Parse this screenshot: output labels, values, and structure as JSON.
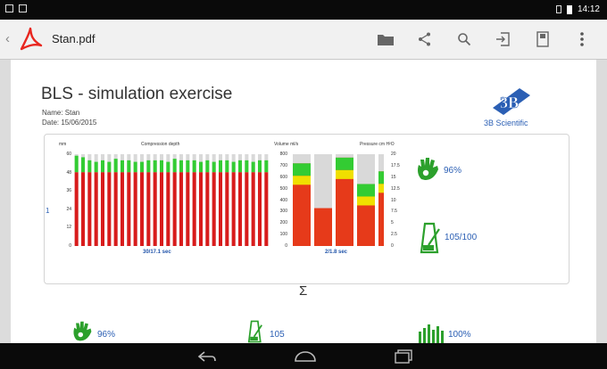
{
  "status": {
    "time": "14:12"
  },
  "appbar": {
    "back": "‹",
    "title": "Stan.pdf"
  },
  "doc": {
    "title": "BLS - simulation exercise",
    "name": "Name: Stan",
    "date": "Date: 15/06/2015",
    "logo_text": "3B Scientific",
    "logo_mark": "3B",
    "left_marker": "1",
    "sigma": "Σ"
  },
  "chart_data": [
    {
      "type": "bar",
      "title": "Compression depth",
      "ylabel": "mm",
      "ylim": [
        0,
        60
      ],
      "yticks": [
        "60",
        "48",
        "36",
        "24",
        "12",
        "0"
      ],
      "x_summary": "30/17.1 sec",
      "values": [
        59,
        58,
        56,
        55,
        56,
        55,
        57,
        56,
        56,
        55,
        55,
        56,
        56,
        56,
        55,
        57,
        56,
        56,
        56,
        55,
        56,
        55,
        56,
        56,
        55,
        56,
        56,
        55,
        56,
        56
      ],
      "target_zone": [
        50,
        60
      ],
      "colors": {
        "bar": "#d81c1c",
        "target": "#33cc33",
        "empty": "#d9d9d9"
      }
    },
    {
      "type": "bar",
      "title": "Volume ml/s",
      "ylabel": "",
      "ylim": [
        0,
        800
      ],
      "yticks": [
        "800",
        "700",
        "600",
        "500",
        "400",
        "300",
        "200",
        "100",
        "0"
      ],
      "x_summary": "2/1.8 sec",
      "values": [
        720,
        330,
        770,
        540,
        650
      ],
      "colors": {
        "high": "#33cc33",
        "mid": "#f0e000",
        "low": "#e63a1a",
        "empty": "#d9d9d9"
      }
    },
    {
      "type": "axis",
      "title": "Pressure cm H²O",
      "yticks": [
        "20",
        "17.5",
        "15",
        "12.5",
        "10",
        "7.5",
        "5",
        "2.5",
        "0"
      ]
    }
  ],
  "stats": {
    "hand_pct": "96%",
    "rate": "105/100"
  },
  "summary": [
    {
      "icon": "hand-icon",
      "label": "96%"
    },
    {
      "icon": "metronome-icon",
      "label": "105"
    },
    {
      "icon": "bar-chart-icon",
      "label": "100%"
    }
  ]
}
